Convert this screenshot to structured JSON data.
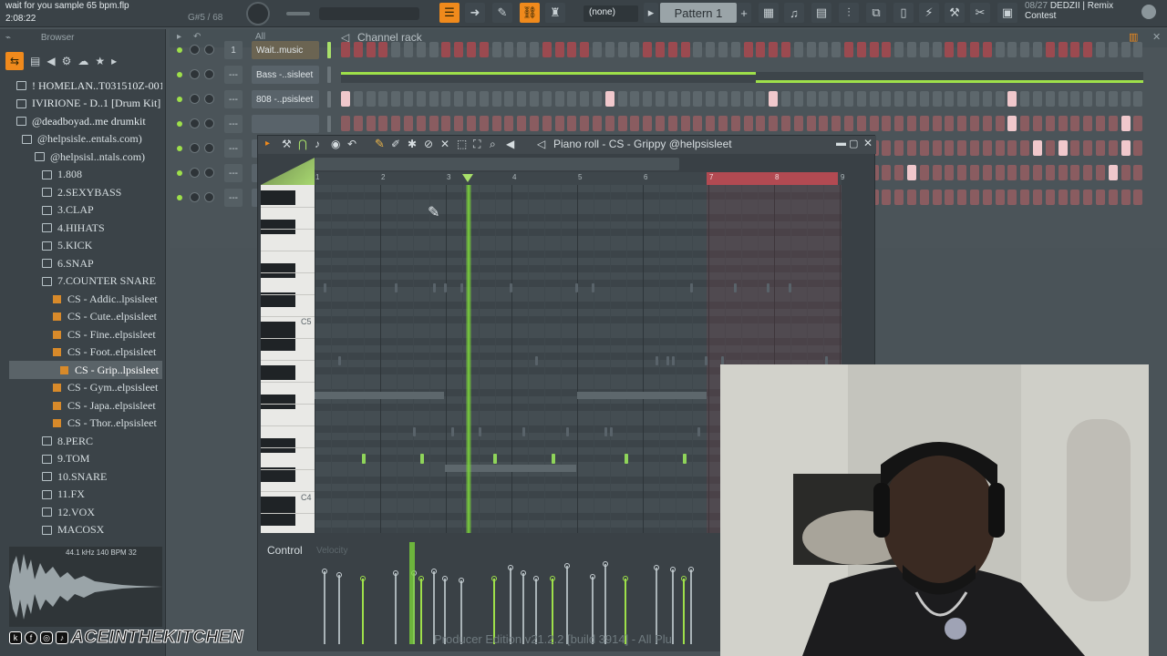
{
  "topbar": {
    "project_name": "wait for you sample 65 bpm.flp",
    "time": "2:08:22",
    "note_info": "G#5 / 68",
    "pattern_selector": "(none)",
    "pattern_label": "Pattern 1",
    "news_date": "08/27",
    "news_line1": "DEDZII | Remix",
    "news_line2": "Contest"
  },
  "browser": {
    "title": "Browser",
    "items": [
      {
        "label": "! HOMELAN..T031510Z-001",
        "type": "pack",
        "indent": 0
      },
      {
        "label": "IVIRIONE - D..1 [Drum Kit]",
        "type": "pack",
        "indent": 0
      },
      {
        "label": "@deadboyad..me drumkit",
        "type": "pack",
        "indent": 0
      },
      {
        "label": "@helpsisle..entals.com)",
        "type": "folder",
        "indent": 1
      },
      {
        "label": "@helpsisl..ntals.com)",
        "type": "folder",
        "indent": 2
      },
      {
        "label": "1.808",
        "type": "folder",
        "indent": 3
      },
      {
        "label": "2.SEXYBASS",
        "type": "folder",
        "indent": 3
      },
      {
        "label": "3.CLAP",
        "type": "folder",
        "indent": 3
      },
      {
        "label": "4.HIHATS",
        "type": "folder",
        "indent": 3
      },
      {
        "label": "5.KICK",
        "type": "folder",
        "indent": 3
      },
      {
        "label": "6.SNAP",
        "type": "folder",
        "indent": 3
      },
      {
        "label": "7.COUNTER SNARE",
        "type": "folder",
        "indent": 3
      },
      {
        "label": "CS - Addic..lpsisleet",
        "type": "file",
        "indent": 4
      },
      {
        "label": "CS - Cute..elpsisleet",
        "type": "file",
        "indent": 4
      },
      {
        "label": "CS - Fine..elpsisleet",
        "type": "file",
        "indent": 4
      },
      {
        "label": "CS - Foot..elpsisleet",
        "type": "file",
        "indent": 4
      },
      {
        "label": "CS - Grip..lpsisleet",
        "type": "file",
        "indent": 5,
        "selected": true
      },
      {
        "label": "CS - Gym..elpsisleet",
        "type": "file",
        "indent": 4
      },
      {
        "label": "CS - Japa..elpsisleet",
        "type": "file",
        "indent": 4
      },
      {
        "label": "CS - Thor..elpsisleet",
        "type": "file",
        "indent": 4
      },
      {
        "label": "8.PERC",
        "type": "folder",
        "indent": 3
      },
      {
        "label": "9.TOM",
        "type": "folder",
        "indent": 3
      },
      {
        "label": "10.SNARE",
        "type": "folder",
        "indent": 3
      },
      {
        "label": "11.FX",
        "type": "folder",
        "indent": 3
      },
      {
        "label": "12.VOX",
        "type": "folder",
        "indent": 3
      },
      {
        "label": "MACOSX",
        "type": "folder",
        "indent": 3
      }
    ],
    "waveform_info": "44.1 kHz 140 BPM 32"
  },
  "channel_rack": {
    "filter": "All",
    "title": "Channel rack",
    "channels": [
      {
        "number": "1",
        "name": "Wait..music",
        "active": true
      },
      {
        "number": "---",
        "name": "Bass -..sisleet",
        "active": false
      },
      {
        "number": "---",
        "name": "808 -..psisleet",
        "active": false
      },
      {
        "number": "---",
        "name": "",
        "active": false
      },
      {
        "number": "---",
        "name": "",
        "active": false
      },
      {
        "number": "---",
        "name": "",
        "active": false
      },
      {
        "number": "---",
        "name": "",
        "active": false
      }
    ]
  },
  "piano_roll": {
    "title": "Piano roll - CS - Grippy @helpsisleet",
    "bars": [
      "1",
      "2",
      "3",
      "4",
      "5",
      "6",
      "7",
      "8",
      "9"
    ],
    "key_labels": [
      "C5",
      "C4"
    ],
    "control_label": "Control",
    "control_param": "Velocity"
  },
  "footer": {
    "version": "Producer Edition v21.2.2 [build 3914] - All Plu",
    "watermark": "ACEINTHEKITCHEN"
  }
}
